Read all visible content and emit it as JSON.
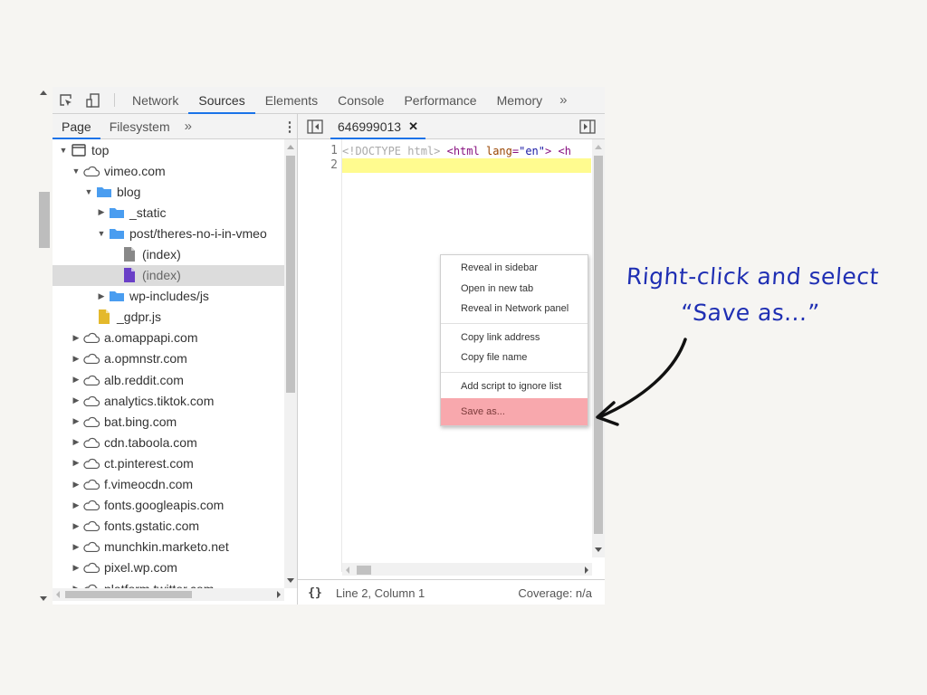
{
  "devtools": {
    "main_tabs": [
      {
        "label": "Network",
        "active": false
      },
      {
        "label": "Sources",
        "active": true
      },
      {
        "label": "Elements",
        "active": false
      },
      {
        "label": "Console",
        "active": false
      },
      {
        "label": "Performance",
        "active": false
      },
      {
        "label": "Memory",
        "active": false
      }
    ],
    "more_tabs_glyph": "»",
    "navigator": {
      "tabs": [
        {
          "label": "Page",
          "active": true
        },
        {
          "label": "Filesystem",
          "active": false
        }
      ],
      "more_glyph": "»",
      "menu_glyph": "⋮",
      "tree": [
        {
          "label": "top",
          "depth": 0,
          "expander": "open",
          "icon": "frame"
        },
        {
          "label": "vimeo.com",
          "depth": 1,
          "expander": "open",
          "icon": "cloud"
        },
        {
          "label": "blog",
          "depth": 2,
          "expander": "open",
          "icon": "folder"
        },
        {
          "label": "_static",
          "depth": 3,
          "expander": "closed",
          "icon": "folder"
        },
        {
          "label": "post/theres-no-i-in-vmeo",
          "depth": 3,
          "expander": "open",
          "icon": "folder"
        },
        {
          "label": "(index)",
          "depth": 4,
          "expander": "none",
          "icon": "file-gray"
        },
        {
          "label": "(index)",
          "depth": 4,
          "expander": "none",
          "icon": "file-purple",
          "selected": true
        },
        {
          "label": "wp-includes/js",
          "depth": 3,
          "expander": "closed",
          "icon": "folder"
        },
        {
          "label": "_gdpr.js",
          "depth": 2,
          "expander": "none",
          "icon": "file-yellow"
        },
        {
          "label": "a.omappapi.com",
          "depth": 1,
          "expander": "closed",
          "icon": "cloud"
        },
        {
          "label": "a.opmnstr.com",
          "depth": 1,
          "expander": "closed",
          "icon": "cloud"
        },
        {
          "label": "alb.reddit.com",
          "depth": 1,
          "expander": "closed",
          "icon": "cloud"
        },
        {
          "label": "analytics.tiktok.com",
          "depth": 1,
          "expander": "closed",
          "icon": "cloud"
        },
        {
          "label": "bat.bing.com",
          "depth": 1,
          "expander": "closed",
          "icon": "cloud"
        },
        {
          "label": "cdn.taboola.com",
          "depth": 1,
          "expander": "closed",
          "icon": "cloud"
        },
        {
          "label": "ct.pinterest.com",
          "depth": 1,
          "expander": "closed",
          "icon": "cloud"
        },
        {
          "label": "f.vimeocdn.com",
          "depth": 1,
          "expander": "closed",
          "icon": "cloud"
        },
        {
          "label": "fonts.googleapis.com",
          "depth": 1,
          "expander": "closed",
          "icon": "cloud"
        },
        {
          "label": "fonts.gstatic.com",
          "depth": 1,
          "expander": "closed",
          "icon": "cloud"
        },
        {
          "label": "munchkin.marketo.net",
          "depth": 1,
          "expander": "closed",
          "icon": "cloud"
        },
        {
          "label": "pixel.wp.com",
          "depth": 1,
          "expander": "closed",
          "icon": "cloud"
        },
        {
          "label": "platform.twitter.com",
          "depth": 1,
          "expander": "closed",
          "icon": "cloud"
        }
      ]
    },
    "editor": {
      "file_tab": {
        "label": "646999013",
        "close_glyph": "✕"
      },
      "line_numbers": [
        "1",
        "2"
      ],
      "line1_tokens": [
        {
          "t": "<!DOCTYPE html>",
          "c": "doctype"
        },
        {
          "t": " ",
          "c": "plain"
        },
        {
          "t": "<html",
          "c": "tag"
        },
        {
          "t": " ",
          "c": "plain"
        },
        {
          "t": "lang",
          "c": "attr"
        },
        {
          "t": "=",
          "c": "tag"
        },
        {
          "t": "\"en\"",
          "c": "val"
        },
        {
          "t": ">",
          "c": "tag"
        },
        {
          "t": " ",
          "c": "plain"
        },
        {
          "t": "<h",
          "c": "tag"
        }
      ],
      "status": {
        "pretty_print_glyph": "{}",
        "cursor": "Line 2, Column 1",
        "coverage": "Coverage: n/a"
      }
    },
    "context_menu": {
      "groups": [
        [
          "Reveal in sidebar",
          "Open in new tab",
          "Reveal in Network panel"
        ],
        [
          "Copy link address",
          "Copy file name"
        ],
        [
          "Add script to ignore list"
        ]
      ],
      "highlighted_item": "Save as..."
    }
  },
  "annotation": {
    "line1": "Right-click and select",
    "line2": "“Save as...”",
    "color": "#1f2fb3"
  },
  "colors": {
    "accent": "#1a73e8",
    "highlight_line": "#fffb8f",
    "menu_highlight": "#f8a8ad",
    "folder": "#4a9df0",
    "file_purple": "#6a3fc7",
    "file_yellow": "#e4b92c",
    "file_gray": "#888888"
  }
}
